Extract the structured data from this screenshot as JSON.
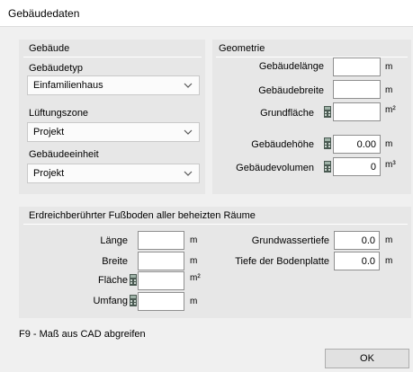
{
  "window": {
    "title": "Gebäudedaten"
  },
  "building": {
    "header": "Gebäude",
    "type_label": "Gebäudetyp",
    "type_value": "Einfamilienhaus",
    "vent_label": "Lüftungszone",
    "vent_value": "Projekt",
    "unit_label": "Gebäudeeinheit",
    "unit_value": "Projekt"
  },
  "geometry": {
    "header": "Geometrie",
    "length_label": "Gebäudelänge",
    "length_value": "",
    "length_unit": "m",
    "width_label": "Gebäudebreite",
    "width_value": "",
    "width_unit": "m",
    "area_label": "Grundfläche",
    "area_value": "",
    "area_unit": "m²",
    "height_label": "Gebäudehöhe",
    "height_value": "0.00",
    "height_unit": "m",
    "volume_label": "Gebäudevolumen",
    "volume_value": "0",
    "volume_unit": "m³"
  },
  "floor": {
    "header": "Erdreichberührter Fußboden aller beheizten Räume",
    "length_label": "Länge",
    "length_value": "",
    "length_unit": "m",
    "width_label": "Breite",
    "width_value": "",
    "width_unit": "m",
    "area_label": "Fläche",
    "area_value": "",
    "area_unit": "m²",
    "perimeter_label": "Umfang",
    "perimeter_value": "",
    "perimeter_unit": "m",
    "groundwater_label": "Grundwassertiefe",
    "groundwater_value": "0.0",
    "groundwater_unit": "m",
    "slab_label": "Tiefe der Bodenplatte",
    "slab_value": "0.0",
    "slab_unit": "m"
  },
  "footer": {
    "hint": "F9 - Maß aus CAD abgreifen",
    "ok_label": "OK"
  },
  "colors": {
    "panel": "#e7e7e7",
    "window": "#f0f0f0",
    "calc_icon": "#4a5a52"
  }
}
